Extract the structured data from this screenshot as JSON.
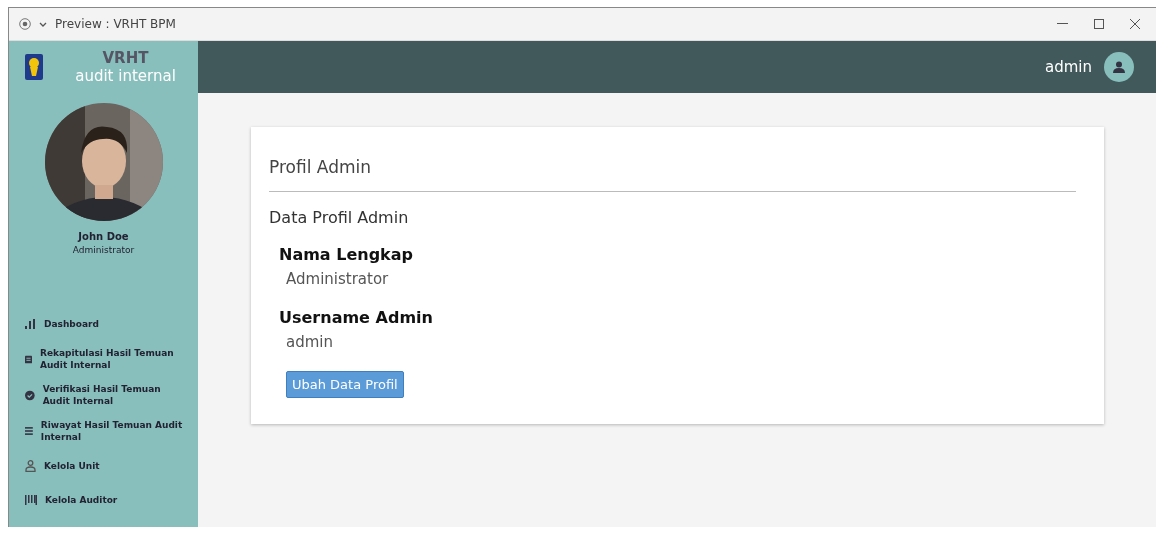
{
  "window": {
    "title": "Preview : VRHT BPM"
  },
  "brand": {
    "title": "VRHT",
    "subtitle": "audit internal"
  },
  "profile": {
    "name": "John Doe",
    "role": "Administrator"
  },
  "nav": [
    {
      "kind": "chart",
      "label": "Dashboard"
    },
    {
      "kind": "list",
      "label": "Rekapitulasi Hasil Temuan Audit Internal"
    },
    {
      "kind": "check",
      "label": "Verifikasi Hasil Temuan Audit Internal"
    },
    {
      "kind": "menu",
      "label": "Riwayat Hasil Temuan Audit Internal"
    },
    {
      "kind": "user",
      "label": "Kelola Unit"
    },
    {
      "kind": "bars",
      "label": "Kelola Auditor"
    }
  ],
  "topbar": {
    "user": "admin"
  },
  "card": {
    "title": "Profil Admin",
    "subtitle": "Data Profil Admin",
    "fields": [
      {
        "label": "Nama Lengkap",
        "value": "Administrator"
      },
      {
        "label": "Username Admin",
        "value": "admin"
      }
    ],
    "button": "Ubah Data Profil"
  }
}
